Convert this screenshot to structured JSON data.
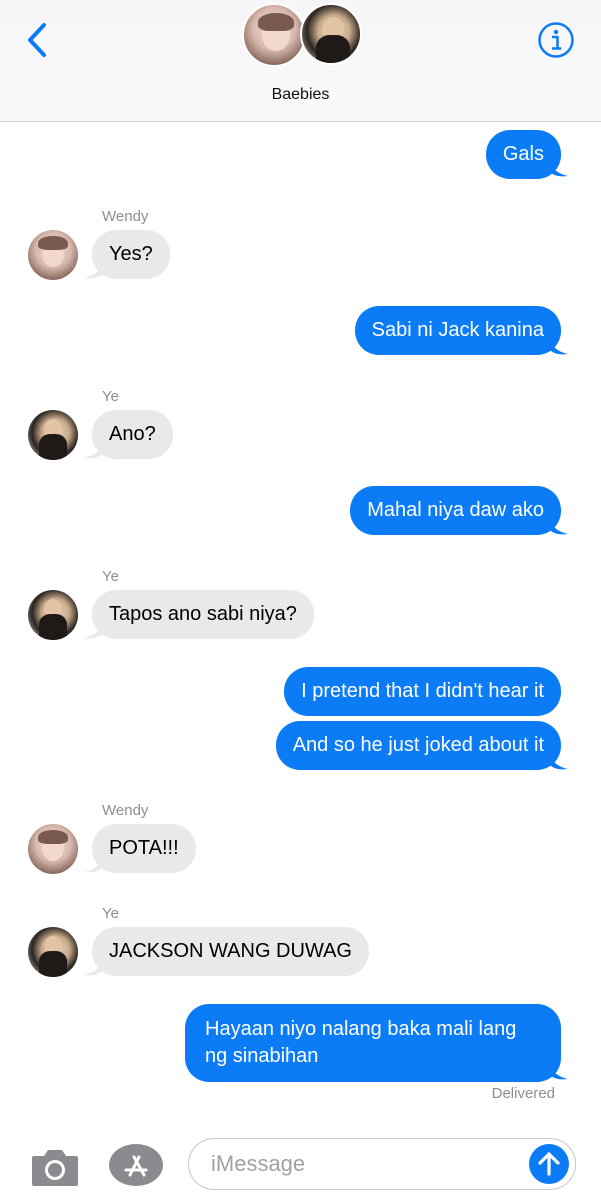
{
  "header": {
    "group_name": "Baebies",
    "back_icon": "chevron-left-icon",
    "info_icon": "info-icon"
  },
  "colors": {
    "accent": "#0b7cf6",
    "incoming_bubble": "#e9e9eb",
    "secondary_text": "#8e8e93"
  },
  "messages": [
    {
      "direction": "out",
      "text": "Gals"
    },
    {
      "direction": "in",
      "sender": "Wendy",
      "text": "Yes?"
    },
    {
      "direction": "out",
      "text": "Sabi ni Jack kanina"
    },
    {
      "direction": "in",
      "sender": "Ye",
      "text": "Ano?"
    },
    {
      "direction": "out",
      "text": "Mahal niya daw ako"
    },
    {
      "direction": "in",
      "sender": "Ye",
      "text": "Tapos ano sabi niya?"
    },
    {
      "direction": "out",
      "text": "I pretend that I didn't hear it"
    },
    {
      "direction": "out",
      "text": "And so he just joked about it"
    },
    {
      "direction": "in",
      "sender": "Wendy",
      "text": "POTA!!!"
    },
    {
      "direction": "in",
      "sender": "Ye",
      "text": "JACKSON WANG DUWAG"
    },
    {
      "direction": "out",
      "text": "Hayaan niyo nalang baka mali lang ng sinabihan"
    }
  ],
  "status": "Delivered",
  "composer": {
    "placeholder": "iMessage",
    "camera_icon": "camera-icon",
    "apps_icon": "app-store-icon",
    "send_icon": "send-arrow-up-icon"
  }
}
